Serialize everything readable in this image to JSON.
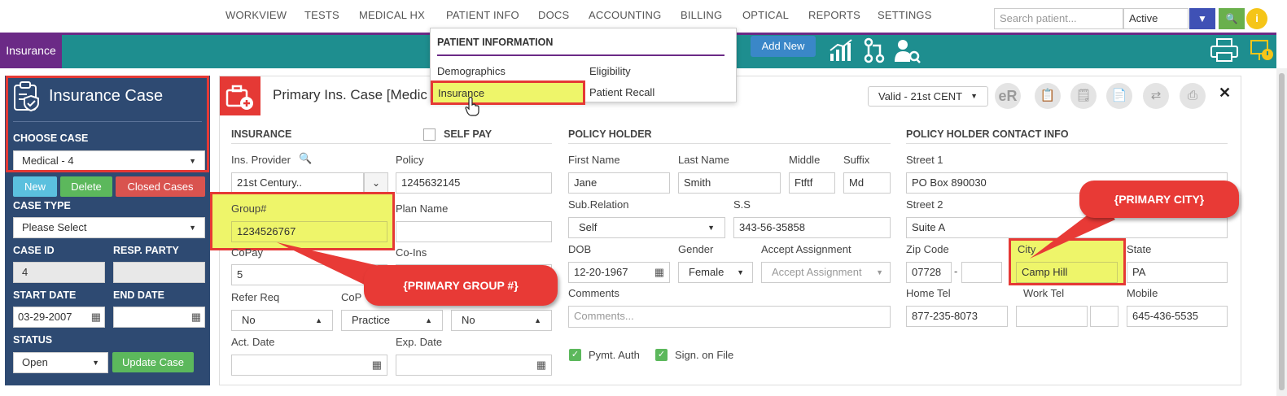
{
  "nav": {
    "items": [
      "WORKVIEW",
      "TESTS",
      "MEDICAL HX",
      "PATIENT INFO",
      "DOCS",
      "ACCOUNTING",
      "BILLING",
      "OPTICAL",
      "REPORTS",
      "SETTINGS"
    ],
    "search_placeholder": "Search patient...",
    "status_value": "Active"
  },
  "toolbar": {
    "tab_label": "Insurance",
    "add_new_label": "Add New"
  },
  "dropdown": {
    "header": "PATIENT INFORMATION",
    "items": [
      "Demographics",
      "Eligibility",
      "Insurance",
      "Patient Recall"
    ]
  },
  "sidebar": {
    "title": "Insurance Case",
    "choose_case_label": "CHOOSE CASE",
    "choose_case_value": "Medical - 4",
    "btn_new": "New",
    "btn_delete": "Delete",
    "btn_closed": "Closed Cases",
    "case_type_label": "CASE TYPE",
    "case_type_value": "Please Select",
    "case_id_label": "CASE ID",
    "case_id_value": "4",
    "resp_party_label": "RESP. PARTY",
    "start_date_label": "START DATE",
    "start_date_value": "03-29-2007",
    "end_date_label": "END DATE",
    "status_label": "STATUS",
    "status_value": "Open",
    "update_btn": "Update Case"
  },
  "case_header": {
    "title": "Primary Ins. Case [Medic",
    "valid_label": "Valid - 21st CENT",
    "er_label": "eR"
  },
  "insurance": {
    "section_title": "INSURANCE",
    "self_pay_label": "SELF PAY",
    "provider_label": "Ins. Provider",
    "provider_value": "21st Century..",
    "policy_label": "Policy",
    "policy_value": "1245632145",
    "group_label": "Group#",
    "group_value": "1234526767",
    "plan_label": "Plan Name",
    "copay_label": "CoPay",
    "copay_value": "5",
    "coins_label": "Co-Ins",
    "refer_label": "Refer Req",
    "refer_value": "No",
    "cop_label": "CoP",
    "practice_value": "Practice",
    "no2_value": "No",
    "act_date_label": "Act. Date",
    "exp_date_label": "Exp. Date"
  },
  "policy_holder": {
    "section_title": "POLICY HOLDER",
    "first_label": "First Name",
    "first_value": "Jane",
    "last_label": "Last Name",
    "last_value": "Smith",
    "middle_label": "Middle",
    "middle_value": "Ftftf",
    "suffix_label": "Suffix",
    "suffix_value": "Md",
    "relation_label": "Sub.Relation",
    "relation_value": "Self",
    "ss_label": "S.S",
    "ss_value": "343-56-35858",
    "dob_label": "DOB",
    "dob_value": "12-20-1967",
    "gender_label": "Gender",
    "gender_value": "Female",
    "accept_label": "Accept Assignment",
    "accept_value": "Accept Assignment",
    "comments_label": "Comments",
    "comments_placeholder": "Comments...",
    "pymt_label": "Pymt. Auth",
    "sign_label": "Sign. on File"
  },
  "contact": {
    "section_title": "POLICY HOLDER CONTACT INFO",
    "street1_label": "Street 1",
    "street1_value": "PO Box 890030",
    "street2_label": "Street 2",
    "street2_value": "Suite A",
    "zip_label": "Zip Code",
    "zip_value": "07728",
    "zip_dash": "-",
    "city_label": "City",
    "city_value": "Camp Hill",
    "state_label": "State",
    "state_value": "PA",
    "home_label": "Home Tel",
    "home_value": "877-235-8073",
    "work_label": "Work Tel",
    "mobile_label": "Mobile",
    "mobile_value": "645-436-5535"
  },
  "callouts": {
    "group": "{PRIMARY GROUP #}",
    "city": "{PRIMARY CITY}"
  },
  "colors": {
    "teal": "#1e8e8f",
    "purple": "#6b2a86",
    "sidebar": "#2e4a72",
    "highlight": "#eef56a",
    "callout": "#e83a36"
  }
}
